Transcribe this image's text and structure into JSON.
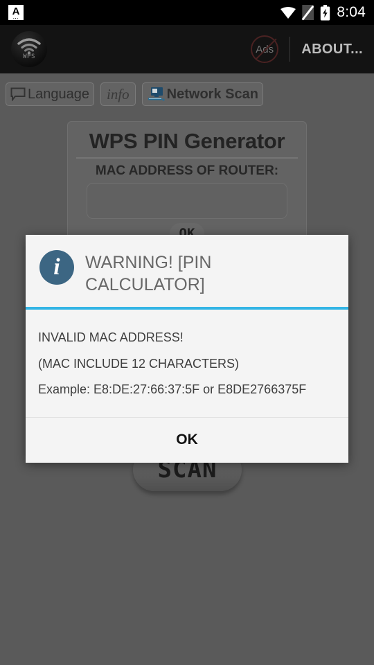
{
  "statusbar": {
    "notification_letter": "A",
    "notification_sub": "...",
    "icons": [
      "wifi-icon",
      "no-sim-icon",
      "battery-charging-icon"
    ],
    "clock": "8:04"
  },
  "appbar": {
    "logo_label": "WPS",
    "ads_label": "Ads",
    "about_label": "ABOUT..."
  },
  "toolbar": {
    "language_label": "Language",
    "info_label": "info",
    "network_scan_label": "Network Scan"
  },
  "card": {
    "title": "WPS PIN Generator",
    "field_label": "MAC ADDRESS OF ROUTER:",
    "mac_value": "",
    "mac_placeholder": "",
    "ok_label": "OK"
  },
  "scan_button": {
    "label": "SCAN"
  },
  "dialog": {
    "icon": "info-icon",
    "title": "WARNING! [PIN CALCULATOR]",
    "lines": [
      "INVALID MAC ADDRESS!",
      "(MAC INCLUDE 12 CHARACTERS)",
      "Example: E8:DE:27:66:37:5F or E8DE2766375F"
    ],
    "ok_label": "OK"
  },
  "colors": {
    "accent": "#33b5e5",
    "dialog_bg": "#f4f4f4",
    "info_icon": "#3c6683",
    "scrim": "#5a5a5a",
    "appbar": "#131313"
  }
}
